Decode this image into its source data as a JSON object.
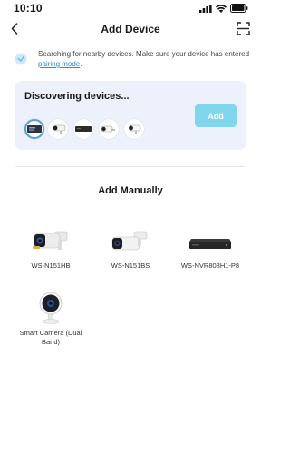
{
  "status_bar": {
    "time": "10:10"
  },
  "header": {
    "title": "Add Device"
  },
  "hint": {
    "text": "Searching for nearby devices. Make sure your device has entered ",
    "link": "pairing mode",
    "suffix": "."
  },
  "discover": {
    "title": "Discovering devices...",
    "add_label": "Add",
    "devices": [
      "nvr",
      "camera",
      "nvr",
      "camera",
      "camera"
    ]
  },
  "manual": {
    "title": "Add Manually",
    "products": [
      {
        "name": "WS-N151HB",
        "icon": "bullet-camera-black"
      },
      {
        "name": "WS-N151BS",
        "icon": "bullet-camera-white"
      },
      {
        "name": "WS-NVR808H1-P8",
        "icon": "nvr-recorder"
      },
      {
        "name": "Smart Camera (Dual Band)",
        "icon": "indoor-smart-camera"
      }
    ]
  },
  "colors": {
    "accent": "#80d6ec",
    "link": "#2f8bd8",
    "card_bg": "#edf1fb"
  }
}
